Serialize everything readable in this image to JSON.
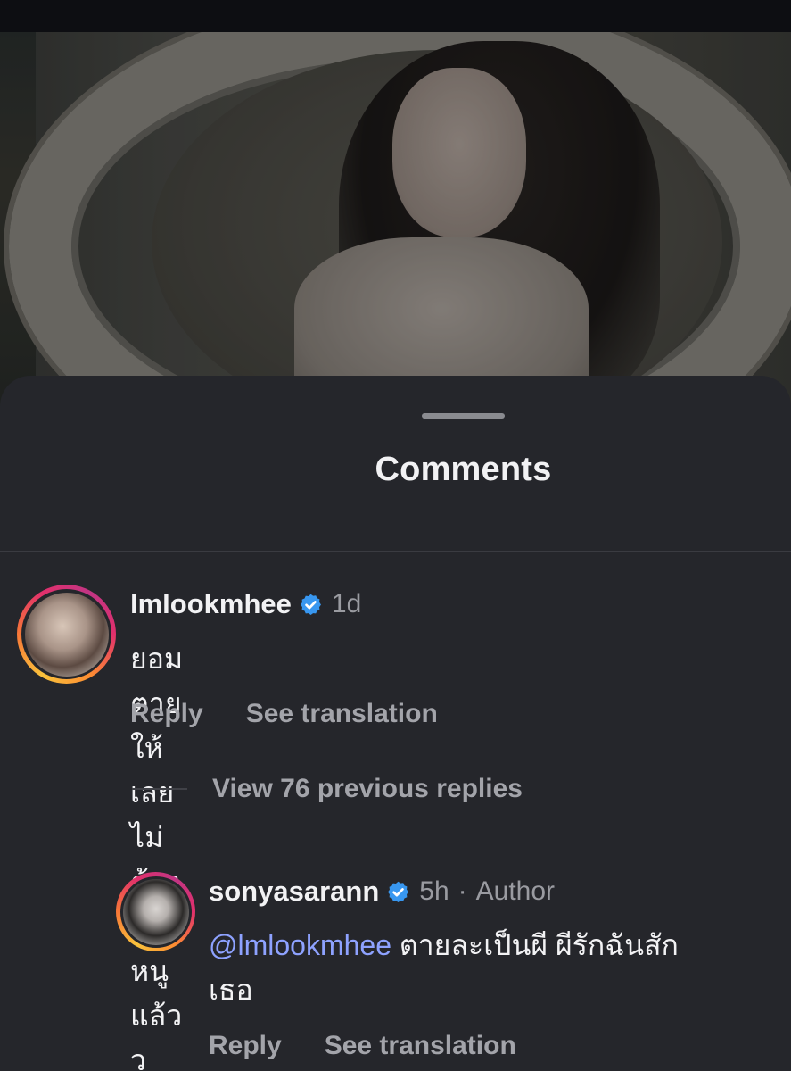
{
  "sheet": {
    "title": "Comments"
  },
  "comments": [
    {
      "username": "lmlookmhee",
      "verified": true,
      "time": "1d",
      "text": "ยอมตายให้เลย ไม่ต้องฆ่าหนูแล้วว",
      "actions": {
        "reply": "Reply",
        "translate": "See translation"
      }
    }
  ],
  "view_replies": "View 76 previous replies",
  "reply": {
    "username": "sonyasarann",
    "verified": true,
    "time": "5h",
    "separator": "·",
    "author_tag": "Author",
    "mention": "@lmlookmhee",
    "text": " ตายละเป็นผี ผีรักฉันสัก\nเธอ",
    "actions": {
      "reply": "Reply",
      "translate": "See translation"
    }
  },
  "colors": {
    "sheet_background": "#25262b",
    "mention": "#8ea2ff",
    "verified_badge": "#3897f0"
  },
  "icons": {
    "verified": "verified-badge-icon"
  }
}
